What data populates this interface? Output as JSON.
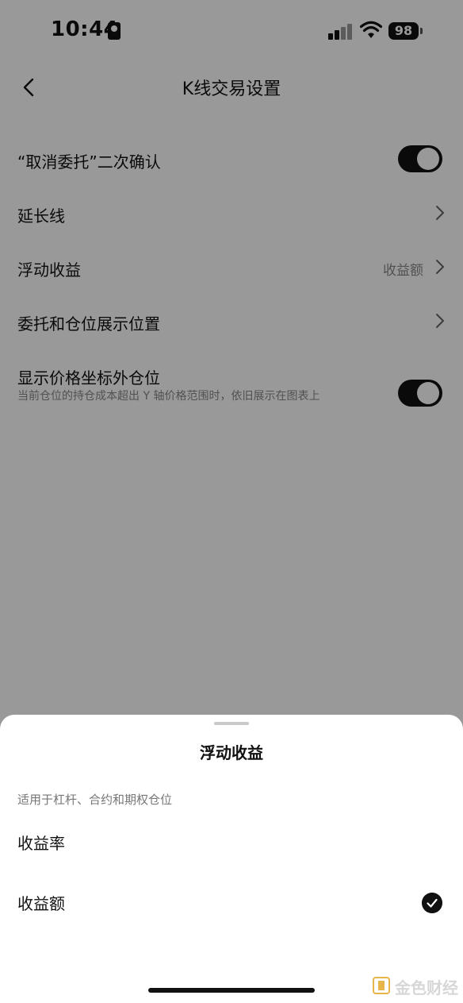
{
  "status_bar": {
    "time": "10:44",
    "battery": "98"
  },
  "nav": {
    "title": "K线交易设置"
  },
  "settings": {
    "cancel_confirm": {
      "label": "“取消委托”二次确认",
      "toggle_on": true
    },
    "extension_line": {
      "label": "延长线"
    },
    "floating_pnl": {
      "label": "浮动收益",
      "value": "收益额"
    },
    "order_position_display": {
      "label": "委托和仓位展示位置"
    },
    "show_out_of_range": {
      "label": "显示价格坐标外仓位",
      "description": "当前仓位的持仓成本超出 Y 轴价格范围时，依旧展示在图表上",
      "toggle_on": true
    }
  },
  "sheet": {
    "title": "浮动收益",
    "note": "适用于杠杆、合约和期权仓位",
    "options": [
      {
        "label": "收益率",
        "selected": false
      },
      {
        "label": "收益额",
        "selected": true
      }
    ]
  },
  "watermark": {
    "text": "金色财经"
  },
  "colors": {
    "toggle_on": "#111111",
    "overlay": "rgba(0,0,0,0.40)",
    "watermark_logo": "#e7b54a"
  }
}
